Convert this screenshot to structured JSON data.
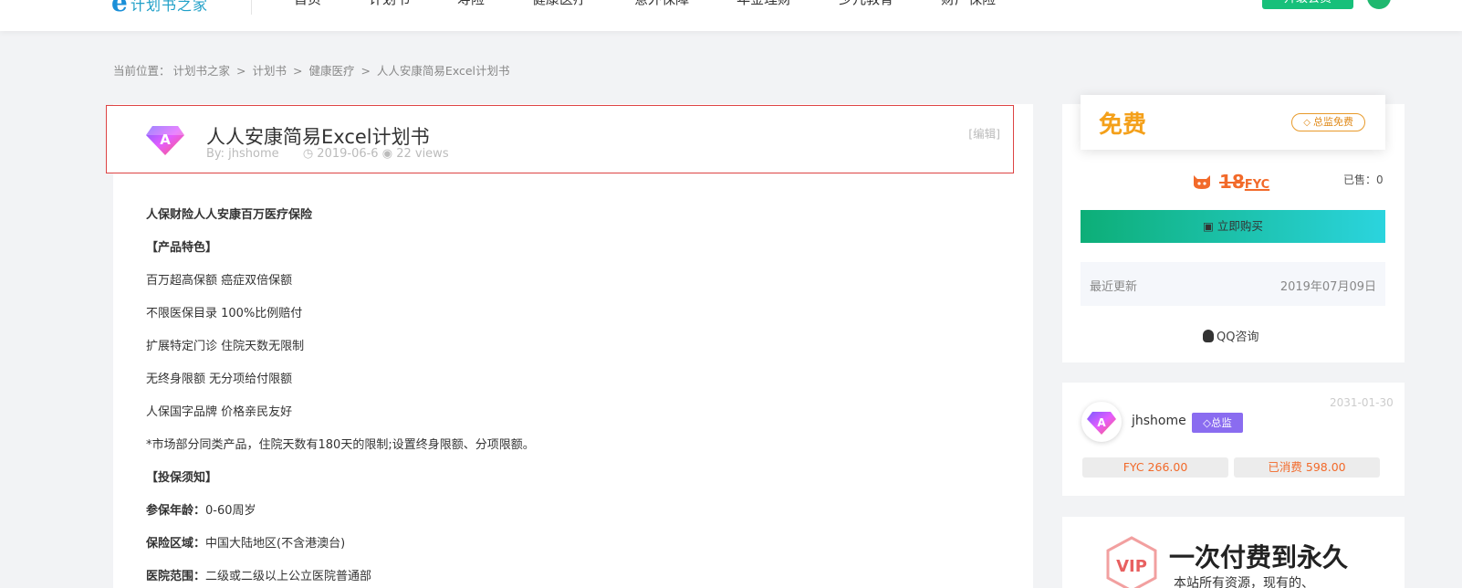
{
  "nav": {
    "logo_mark": "e",
    "logo_text": "计划书之家",
    "items": [
      "首页",
      "计划书",
      "寿险",
      "健康医疗",
      "意外保障",
      "年金理财",
      "少儿教育",
      "财产保险"
    ],
    "action_label": "升级会员"
  },
  "breadcrumb": {
    "prefix": "当前位置：",
    "items": [
      "计划书之家",
      "计划书",
      "健康医疗",
      "人人安康简易Excel计划书"
    ],
    "separator": ">"
  },
  "article": {
    "title": "人人安康简易Excel计划书",
    "author": "By: jhshome",
    "date": "2019-06-6",
    "views": "22 views",
    "edit_label": "[编辑]",
    "paragraphs": [
      {
        "text": "人保财险人人安康百万医疗保险",
        "bold": true
      },
      {
        "text": "【产品特色】",
        "bold": true
      },
      {
        "text": "百万超高保额 癌症双倍保额",
        "bold": false
      },
      {
        "text": "不限医保目录 100%比例赔付",
        "bold": false
      },
      {
        "text": "扩展特定门诊 住院天数无限制",
        "bold": false
      },
      {
        "text": "无终身限额 无分项给付限额",
        "bold": false
      },
      {
        "text": "人保国字品牌 价格亲民友好",
        "bold": false
      },
      {
        "text": "*市场部分同类产品，住院天数有180天的限制;设置终身限额、分项限额。",
        "bold": false
      },
      {
        "text": "【投保须知】",
        "bold": true
      }
    ],
    "fields": [
      {
        "label": "参保年龄：",
        "value": "0-60周岁"
      },
      {
        "label": "保险区域：",
        "value": "中国大陆地区(不含港澳台)"
      },
      {
        "label": "医院范围：",
        "value": "二级或二级以上公立医院普通部"
      }
    ]
  },
  "purchase": {
    "free_label": "免费",
    "vip_free_label": "总监免费",
    "old_price": "18",
    "currency": "FYC",
    "sold_label": "已售：0",
    "buy_label": "立即购买",
    "update_label": "最近更新",
    "update_date": "2019年07月09日",
    "qq_label": "QQ咨询"
  },
  "author_card": {
    "date": "2031-01-30",
    "name": "jhshome",
    "badge": "总监",
    "fyc": "FYC 266.00",
    "spent": "已消费 598.00"
  },
  "vip_promo": {
    "hex_label": "VIP",
    "headline": "一次付费到永久",
    "sub": "本站所有资源，现有的、"
  },
  "colors": {
    "accent_green": "#17c07a",
    "price_orange": "#f26a2a",
    "free_gold": "#f4a01a",
    "badge_purple": "#8a6cf0"
  }
}
